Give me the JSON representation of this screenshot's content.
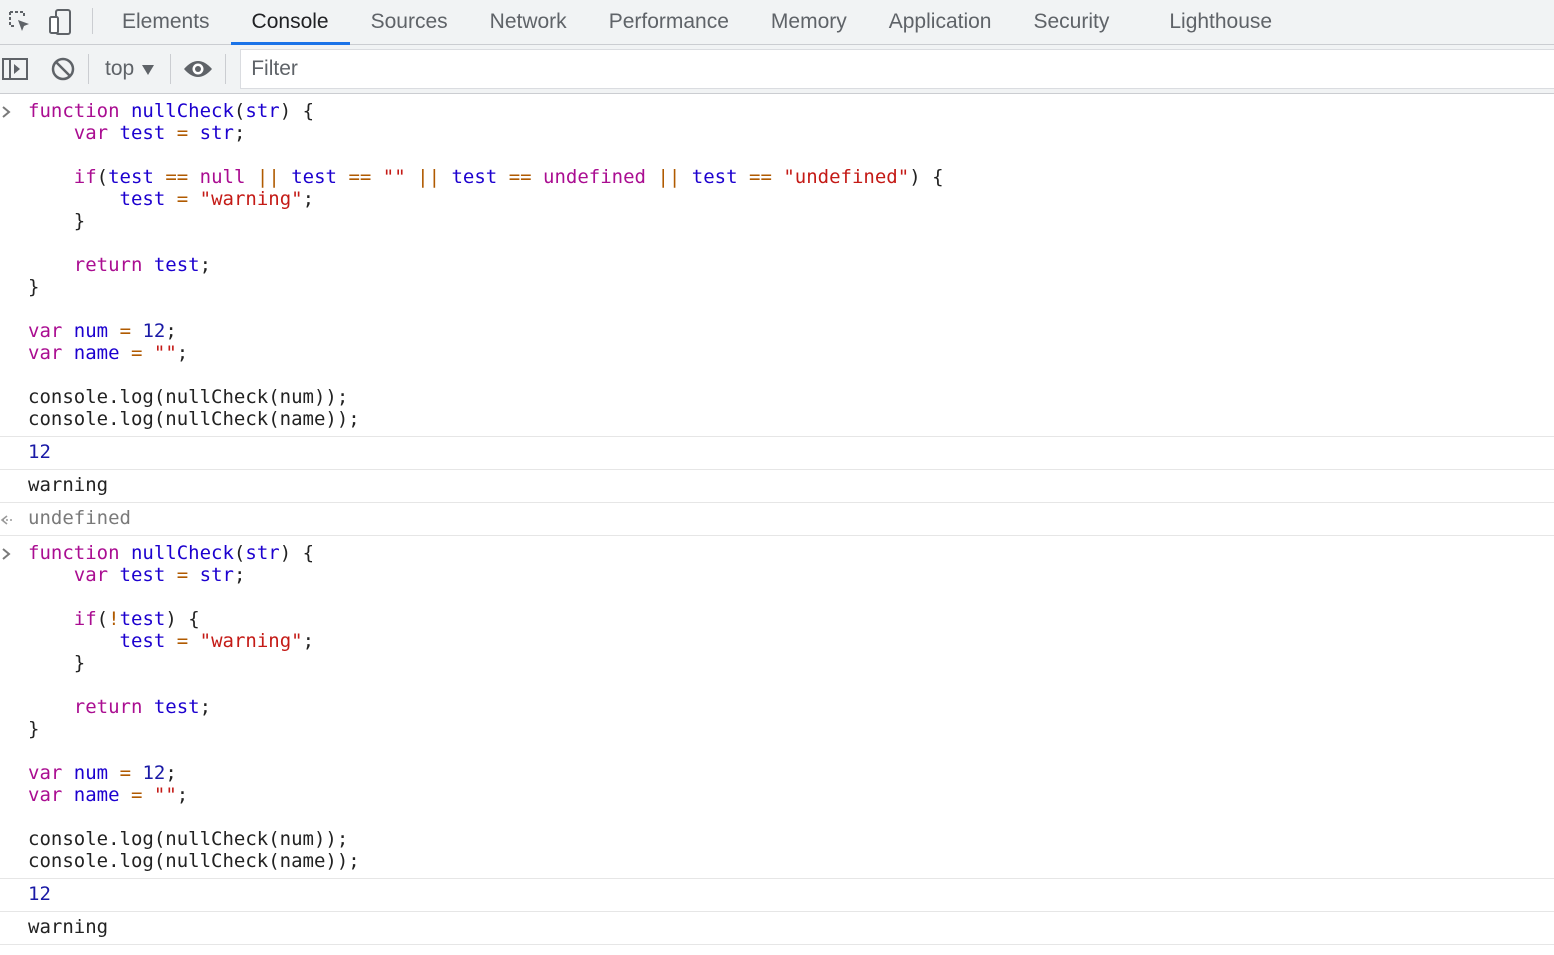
{
  "tabs": [
    "Elements",
    "Console",
    "Sources",
    "Network",
    "Performance",
    "Memory",
    "Application",
    "Security",
    "Lighthouse"
  ],
  "active_tab": "Console",
  "toolbar": {
    "context": "top",
    "filter_placeholder": "Filter"
  },
  "entries": [
    {
      "type": "input",
      "lines": [
        [
          [
            "kw",
            "function"
          ],
          [
            "pl",
            " "
          ],
          [
            "id",
            "nullCheck"
          ],
          [
            "pl",
            "("
          ],
          [
            "id",
            "str"
          ],
          [
            "pl",
            ") {"
          ]
        ],
        [
          [
            "pl",
            "    "
          ],
          [
            "kw",
            "var"
          ],
          [
            "pl",
            " "
          ],
          [
            "id",
            "test"
          ],
          [
            "pl",
            " "
          ],
          [
            "op",
            "="
          ],
          [
            "pl",
            " "
          ],
          [
            "id",
            "str"
          ],
          [
            "pl",
            ";"
          ]
        ],
        [],
        [
          [
            "pl",
            "    "
          ],
          [
            "kw",
            "if"
          ],
          [
            "pl",
            "("
          ],
          [
            "id",
            "test"
          ],
          [
            "pl",
            " "
          ],
          [
            "op",
            "=="
          ],
          [
            "pl",
            " "
          ],
          [
            "kw",
            "null"
          ],
          [
            "pl",
            " "
          ],
          [
            "op",
            "||"
          ],
          [
            "pl",
            " "
          ],
          [
            "id",
            "test"
          ],
          [
            "pl",
            " "
          ],
          [
            "op",
            "=="
          ],
          [
            "pl",
            " "
          ],
          [
            "st",
            "\"\""
          ],
          [
            "pl",
            " "
          ],
          [
            "op",
            "||"
          ],
          [
            "pl",
            " "
          ],
          [
            "id",
            "test"
          ],
          [
            "pl",
            " "
          ],
          [
            "op",
            "=="
          ],
          [
            "pl",
            " "
          ],
          [
            "kw",
            "undefined"
          ],
          [
            "pl",
            " "
          ],
          [
            "op",
            "||"
          ],
          [
            "pl",
            " "
          ],
          [
            "id",
            "test"
          ],
          [
            "pl",
            " "
          ],
          [
            "op",
            "=="
          ],
          [
            "pl",
            " "
          ],
          [
            "st",
            "\"undefined\""
          ],
          [
            "pl",
            ") {"
          ]
        ],
        [
          [
            "pl",
            "        "
          ],
          [
            "id",
            "test"
          ],
          [
            "pl",
            " "
          ],
          [
            "op",
            "="
          ],
          [
            "pl",
            " "
          ],
          [
            "st",
            "\"warning\""
          ],
          [
            "pl",
            ";"
          ]
        ],
        [
          [
            "pl",
            "    }"
          ]
        ],
        [],
        [
          [
            "pl",
            "    "
          ],
          [
            "kw",
            "return"
          ],
          [
            "pl",
            " "
          ],
          [
            "id",
            "test"
          ],
          [
            "pl",
            ";"
          ]
        ],
        [
          [
            "pl",
            "}"
          ]
        ],
        [],
        [
          [
            "kw",
            "var"
          ],
          [
            "pl",
            " "
          ],
          [
            "id",
            "num"
          ],
          [
            "pl",
            " "
          ],
          [
            "op",
            "="
          ],
          [
            "pl",
            " "
          ],
          [
            "nm",
            "12"
          ],
          [
            "pl",
            ";"
          ]
        ],
        [
          [
            "kw",
            "var"
          ],
          [
            "pl",
            " "
          ],
          [
            "id",
            "name"
          ],
          [
            "pl",
            " "
          ],
          [
            "op",
            "="
          ],
          [
            "pl",
            " "
          ],
          [
            "st",
            "\"\""
          ],
          [
            "pl",
            ";"
          ]
        ],
        [],
        [
          [
            "pl",
            "console.log(nullCheck(num));"
          ]
        ],
        [
          [
            "pl",
            "console.log(nullCheck(name));"
          ]
        ]
      ]
    },
    {
      "type": "output-number",
      "text": "12"
    },
    {
      "type": "output-string",
      "text": "warning"
    },
    {
      "type": "return",
      "text": "undefined"
    },
    {
      "type": "input",
      "lines": [
        [
          [
            "kw",
            "function"
          ],
          [
            "pl",
            " "
          ],
          [
            "id",
            "nullCheck"
          ],
          [
            "pl",
            "("
          ],
          [
            "id",
            "str"
          ],
          [
            "pl",
            ") {"
          ]
        ],
        [
          [
            "pl",
            "    "
          ],
          [
            "kw",
            "var"
          ],
          [
            "pl",
            " "
          ],
          [
            "id",
            "test"
          ],
          [
            "pl",
            " "
          ],
          [
            "op",
            "="
          ],
          [
            "pl",
            " "
          ],
          [
            "id",
            "str"
          ],
          [
            "pl",
            ";"
          ]
        ],
        [],
        [
          [
            "pl",
            "    "
          ],
          [
            "kw",
            "if"
          ],
          [
            "pl",
            "("
          ],
          [
            "op",
            "!"
          ],
          [
            "id",
            "test"
          ],
          [
            "pl",
            ") {"
          ]
        ],
        [
          [
            "pl",
            "        "
          ],
          [
            "id",
            "test"
          ],
          [
            "pl",
            " "
          ],
          [
            "op",
            "="
          ],
          [
            "pl",
            " "
          ],
          [
            "st",
            "\"warning\""
          ],
          [
            "pl",
            ";"
          ]
        ],
        [
          [
            "pl",
            "    }"
          ]
        ],
        [],
        [
          [
            "pl",
            "    "
          ],
          [
            "kw",
            "return"
          ],
          [
            "pl",
            " "
          ],
          [
            "id",
            "test"
          ],
          [
            "pl",
            ";"
          ]
        ],
        [
          [
            "pl",
            "}"
          ]
        ],
        [],
        [
          [
            "kw",
            "var"
          ],
          [
            "pl",
            " "
          ],
          [
            "id",
            "num"
          ],
          [
            "pl",
            " "
          ],
          [
            "op",
            "="
          ],
          [
            "pl",
            " "
          ],
          [
            "nm",
            "12"
          ],
          [
            "pl",
            ";"
          ]
        ],
        [
          [
            "kw",
            "var"
          ],
          [
            "pl",
            " "
          ],
          [
            "id",
            "name"
          ],
          [
            "pl",
            " "
          ],
          [
            "op",
            "="
          ],
          [
            "pl",
            " "
          ],
          [
            "st",
            "\"\""
          ],
          [
            "pl",
            ";"
          ]
        ],
        [],
        [
          [
            "pl",
            "console.log(nullCheck(num));"
          ]
        ],
        [
          [
            "pl",
            "console.log(nullCheck(name));"
          ]
        ]
      ]
    },
    {
      "type": "output-number",
      "text": "12"
    },
    {
      "type": "output-string",
      "text": "warning"
    }
  ],
  "icons": [
    "inspect-element-icon",
    "device-toolbar-icon",
    "sidebar-toggle-icon",
    "clear-console-icon",
    "dropdown-arrow-icon",
    "live-expression-eye-icon",
    "prompt-chevron-icon",
    "return-arrow-icon"
  ]
}
